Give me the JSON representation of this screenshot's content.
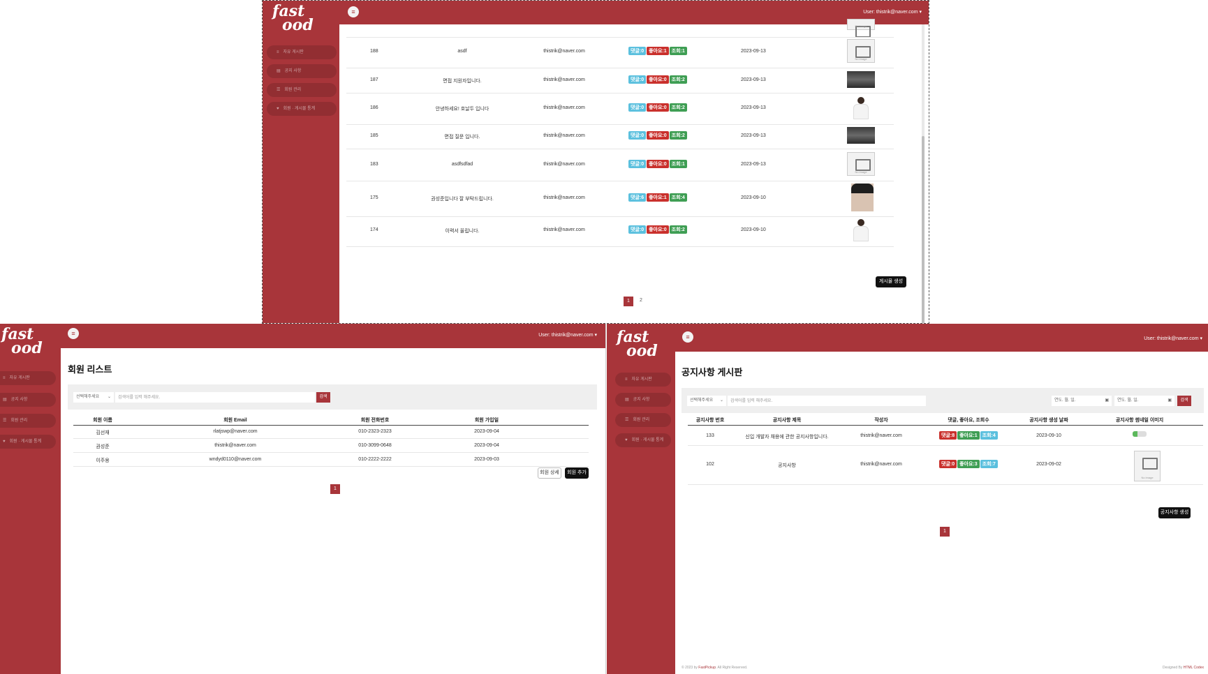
{
  "top_panel": {
    "logo": {
      "line1": "fast",
      "line2": "ood"
    },
    "user_label": "User: thistrik@naver.com",
    "nav": [
      "자유 게시판",
      "공지 사항",
      "회원 관리",
      "회원 · 게시물 통계"
    ],
    "rows": [
      {
        "no": "188",
        "title": "asdf",
        "email": "thistrik@naver.com",
        "comments": "댓글:0",
        "likes": "좋아요:1",
        "views": "조회:1",
        "date": "2023-09-13",
        "thumb": "placeholder"
      },
      {
        "no": "187",
        "title": "면접 지원자입니다.",
        "email": "thistrik@naver.com",
        "comments": "댓글:0",
        "likes": "좋아요:0",
        "views": "조회:2",
        "date": "2023-09-13",
        "thumb": "photo"
      },
      {
        "no": "186",
        "title": "안녕하세요! 호날두 입니다",
        "email": "thistrik@naver.com",
        "comments": "댓글:0",
        "likes": "좋아요:0",
        "views": "조회:2",
        "date": "2023-09-13",
        "thumb": "player"
      },
      {
        "no": "185",
        "title": "면접 질문 입니다.",
        "email": "thistrik@naver.com",
        "comments": "댓글:0",
        "likes": "좋아요:0",
        "views": "조회:2",
        "date": "2023-09-13",
        "thumb": "photo"
      },
      {
        "no": "183",
        "title": "asdfsdfad",
        "email": "thistrik@naver.com",
        "comments": "댓글:0",
        "likes": "좋아요:0",
        "views": "조회:1",
        "date": "2023-09-13",
        "thumb": "placeholder"
      },
      {
        "no": "175",
        "title": "권성준입니다 잘 부탁드립니다.",
        "email": "thistrik@naver.com",
        "comments": "댓글:6",
        "likes": "좋아요:1",
        "views": "조회:4",
        "date": "2023-09-10",
        "thumb": "face"
      },
      {
        "no": "174",
        "title": "이력서 올립니다.",
        "email": "thistrik@naver.com",
        "comments": "댓글:0",
        "likes": "좋아요:0",
        "views": "조회:2",
        "date": "2023-09-10",
        "thumb": "player"
      }
    ],
    "create_button": "게시물 생성",
    "pages": [
      "1",
      "2"
    ]
  },
  "left_panel": {
    "logo": {
      "line1": "fast",
      "line2": "ood"
    },
    "user_label": "User: thistrik@naver.com",
    "nav": [
      "자유 게시판",
      "공지 사항",
      "회원 관리",
      "회원 · 게시물 통계"
    ],
    "title": "회원 리스트",
    "select_placeholder": "선택해주세요",
    "search_placeholder": "검색어를 입력 해주세요.",
    "search_button": "검색",
    "headers": [
      "회원 이름",
      "회원 Email",
      "회원 전화번호",
      "회원 가입일"
    ],
    "rows": [
      {
        "name": "김선재",
        "email": "rlatjswp@naver.com",
        "phone": "010-2323-2323",
        "date": "2023-09-04"
      },
      {
        "name": "권성준",
        "email": "thistrik@naver.com",
        "phone": "010-3099-0648",
        "date": "2023-09-04"
      },
      {
        "name": "이주용",
        "email": "wndyd0110@naver.com",
        "phone": "010-2222-2222",
        "date": "2023-09-03"
      }
    ],
    "detail_button": "회원 상세",
    "add_button": "회원 추가",
    "page": "1"
  },
  "right_panel": {
    "logo": {
      "line1": "fast",
      "line2": "ood"
    },
    "user_label": "User: thistrik@naver.com",
    "nav": [
      "자유 게시판",
      "공지 사항",
      "회원 관리",
      "회원 · 게시물 통계"
    ],
    "title": "공지사항 게시판",
    "select_placeholder": "선택해주세요",
    "search_placeholder": "검색어를 입력 해주세요.",
    "date_placeholder_1": "연도. 월. 일.",
    "date_placeholder_2": "연도. 월. 일.",
    "search_button": "검색",
    "headers": [
      "공지사항 번호",
      "공지사항 제목",
      "작성자",
      "댓글, 좋아요, 조회수",
      "공지사항 생성 날짜",
      "공지사항 썸네일 이미지"
    ],
    "rows": [
      {
        "no": "133",
        "title": "신입 개발자 채용에 관한 공지사항입니다.",
        "author": "thistrik@naver.com",
        "comments": "댓글:8",
        "likes": "좋아요:1",
        "views": "조회:4",
        "date": "2023-09-10"
      },
      {
        "no": "102",
        "title": "공지사항",
        "author": "thistrik@naver.com",
        "comments": "댓글:0",
        "likes": "좋아요:3",
        "views": "조회:7",
        "date": "2023-09-02"
      }
    ],
    "create_button": "공지사항 생성",
    "page": "1",
    "footer_left_prefix": "© 2023 by ",
    "footer_left_brand": "FastPickup",
    "footer_left_suffix": ". All Right Reserved.",
    "footer_right_prefix": "Designed By ",
    "footer_right_brand": "HTML Codex"
  },
  "colors": {
    "brand": "#a8353a",
    "comment_badge": "#5bc0de",
    "like_badge": "#c9302c",
    "view_badge": "#3f9e54"
  }
}
